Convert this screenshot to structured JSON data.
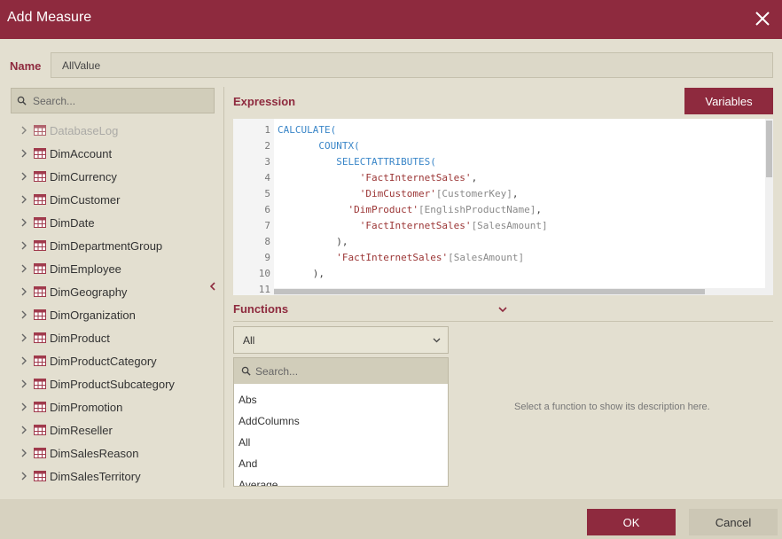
{
  "dialog": {
    "title": "Add Measure",
    "close_icon": "close-icon"
  },
  "name_field": {
    "label": "Name",
    "value": "AllValue"
  },
  "left_panel": {
    "search_placeholder": "Search...",
    "tables": [
      {
        "label": "DatabaseLog",
        "disabled": true
      },
      {
        "label": "DimAccount"
      },
      {
        "label": "DimCurrency"
      },
      {
        "label": "DimCustomer"
      },
      {
        "label": "DimDate"
      },
      {
        "label": "DimDepartmentGroup"
      },
      {
        "label": "DimEmployee"
      },
      {
        "label": "DimGeography"
      },
      {
        "label": "DimOrganization"
      },
      {
        "label": "DimProduct"
      },
      {
        "label": "DimProductCategory"
      },
      {
        "label": "DimProductSubcategory"
      },
      {
        "label": "DimPromotion"
      },
      {
        "label": "DimReseller"
      },
      {
        "label": "DimSalesReason"
      },
      {
        "label": "DimSalesTerritory"
      }
    ],
    "collapse_icon": "chevron-left-icon"
  },
  "expression": {
    "label": "Expression",
    "variables_button": "Variables",
    "lines": [
      {
        "n": "1",
        "indent": "",
        "parts": [
          [
            "kw",
            "CALCULATE"
          ],
          [
            "kw",
            "("
          ]
        ]
      },
      {
        "n": "2",
        "indent": "       ",
        "parts": [
          [
            "kw",
            "COUNTX"
          ],
          [
            "kw",
            "("
          ]
        ]
      },
      {
        "n": "3",
        "indent": "          ",
        "parts": [
          [
            "kw",
            "SELECTATTRIBUTES"
          ],
          [
            "kw",
            "("
          ]
        ]
      },
      {
        "n": "4",
        "indent": "              ",
        "parts": [
          [
            "str",
            "'FactInternetSales'"
          ],
          [
            "pun",
            ","
          ]
        ]
      },
      {
        "n": "5",
        "indent": "              ",
        "parts": [
          [
            "str",
            "'DimCustomer'"
          ],
          [
            "col",
            "[CustomerKey]"
          ],
          [
            "pun",
            ","
          ]
        ]
      },
      {
        "n": "6",
        "indent": "            ",
        "parts": [
          [
            "str",
            "'DimProduct'"
          ],
          [
            "col",
            "[EnglishProductName]"
          ],
          [
            "pun",
            ","
          ]
        ]
      },
      {
        "n": "7",
        "indent": "              ",
        "parts": [
          [
            "str",
            "'FactInternetSales'"
          ],
          [
            "col",
            "[SalesAmount]"
          ]
        ]
      },
      {
        "n": "8",
        "indent": "          ",
        "parts": [
          [
            "pun",
            "),"
          ]
        ]
      },
      {
        "n": "9",
        "indent": "          ",
        "parts": [
          [
            "str",
            "'FactInternetSales'"
          ],
          [
            "col",
            "[SalesAmount]"
          ]
        ]
      },
      {
        "n": "10",
        "indent": "      ",
        "parts": [
          [
            "pun",
            "),"
          ]
        ]
      },
      {
        "n": "11",
        "indent": "",
        "parts": [
          [
            "pun",
            ""
          ]
        ]
      }
    ]
  },
  "functions": {
    "label": "Functions",
    "toggle_icon": "chevron-down-icon",
    "category_selected": "All",
    "search_placeholder": "Search...",
    "items": [
      "Abs",
      "AddColumns",
      "All",
      "And",
      "Average"
    ],
    "description_placeholder": "Select a function to show its description here."
  },
  "footer": {
    "ok_label": "OK",
    "cancel_label": "Cancel"
  },
  "colors": {
    "accent": "#8e2a3e",
    "background": "#e3dfd0",
    "keyword": "#3a86c8",
    "string": "#9b3535"
  }
}
